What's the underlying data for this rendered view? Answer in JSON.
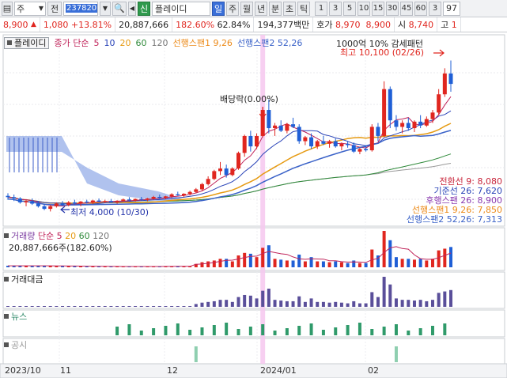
{
  "toolbar": {
    "btn_a": "주",
    "btn_b": "전",
    "code": "237820",
    "credit_badge": "신",
    "stock_name": "플레이디",
    "periods": [
      "일",
      "주",
      "월",
      "년",
      "분",
      "초",
      "틱"
    ],
    "active_period": "일",
    "numbers": [
      "1",
      "3",
      "5",
      "10",
      "15",
      "30",
      "45",
      "60",
      "3"
    ],
    "right_value": "97"
  },
  "info": {
    "price": "8,900",
    "arrow": "▲",
    "change": "1,080",
    "change_pct": "+13.81%",
    "volume": "20,887,666",
    "volume_ratio": "182.60%",
    "turnover": "62.84%",
    "amount": "194,377백만",
    "quote_label": "호가",
    "ask": "8,970",
    "bid": "8,900",
    "low_label": "시",
    "open": "8,740",
    "high_label": "고",
    "high": "1"
  },
  "legend": {
    "name_chip": "플레이디",
    "ma_label": "종가 단순",
    "ma_periods": [
      "5",
      "10",
      "20",
      "60",
      "120"
    ],
    "span1": "선행스팬1 9,26",
    "span2": "선행스팬2 52,26",
    "notice": "1000억 10% 감세패턴"
  },
  "annotations": {
    "high": "최고 10,100 (02/26)",
    "low": "최저 4,000 (10/30)",
    "dividend": "배당락(0.00%)"
  },
  "indicators": [
    {
      "label": "전환선 9: 8,080",
      "color": "#c8243a"
    },
    {
      "label": "기준선 26: 7,620",
      "color": "#2a44b8"
    },
    {
      "label": "후행스팬 26: 8,900",
      "color": "#8a3ab0"
    },
    {
      "label": "선행스팬1 9,26: 7,850",
      "color": "#ec8b1a"
    },
    {
      "label": "선행스팬2 52,26: 7,313",
      "color": "#3a62c8"
    }
  ],
  "volume_panel": {
    "title": "거래량",
    "ma_label": "단순",
    "ma_periods": [
      "5",
      "20",
      "60",
      "120"
    ],
    "current": "20,887,666주(182.60%)"
  },
  "amount_panel": {
    "title": "거래대금"
  },
  "news_panel": {
    "title": "뉴스"
  },
  "disclosure_panel": {
    "title": "공시"
  },
  "x_axis": [
    "2023/10",
    "11",
    "12",
    "2024/01",
    "02"
  ],
  "chart_data": {
    "type": "candlestick",
    "title": "플레이디",
    "period": "daily",
    "high": 10100,
    "high_date": "02/26",
    "low": 4000,
    "low_date": "10/30",
    "ohlc": [
      [
        4600,
        4700,
        4450,
        4550
      ],
      [
        4550,
        4650,
        4400,
        4500
      ],
      [
        4500,
        4550,
        4300,
        4350
      ],
      [
        4350,
        4450,
        4200,
        4400
      ],
      [
        4400,
        4500,
        4250,
        4300
      ],
      [
        4300,
        4400,
        4150,
        4200
      ],
      [
        4200,
        4300,
        4050,
        4100
      ],
      [
        4100,
        4250,
        4000,
        4200
      ],
      [
        4200,
        4350,
        4150,
        4300
      ],
      [
        4300,
        4400,
        4200,
        4250
      ],
      [
        4250,
        4400,
        4200,
        4350
      ],
      [
        4350,
        4450,
        4250,
        4300
      ],
      [
        4300,
        4400,
        4200,
        4380
      ],
      [
        4380,
        4450,
        4300,
        4350
      ],
      [
        4350,
        4450,
        4280,
        4420
      ],
      [
        4420,
        4500,
        4350,
        4380
      ],
      [
        4380,
        4450,
        4320,
        4400
      ],
      [
        4400,
        4480,
        4330,
        4360
      ],
      [
        4360,
        4430,
        4300,
        4410
      ],
      [
        4410,
        4500,
        4380,
        4460
      ],
      [
        4460,
        4550,
        4400,
        4420
      ],
      [
        4420,
        4500,
        4380,
        4480
      ],
      [
        4480,
        4560,
        4420,
        4450
      ],
      [
        4450,
        4520,
        4400,
        4500
      ],
      [
        4500,
        4600,
        4450,
        4560
      ],
      [
        4560,
        4650,
        4480,
        4520
      ],
      [
        4520,
        4600,
        4470,
        4580
      ],
      [
        4580,
        4700,
        4520,
        4660
      ],
      [
        4660,
        4760,
        4600,
        4620
      ],
      [
        4620,
        4700,
        4560,
        4680
      ],
      [
        4680,
        4800,
        4620,
        4750
      ],
      [
        4750,
        4900,
        4700,
        4850
      ],
      [
        4850,
        5100,
        4800,
        5050
      ],
      [
        5050,
        5350,
        5000,
        5250
      ],
      [
        5250,
        5600,
        5200,
        5550
      ],
      [
        5550,
        5900,
        5400,
        5650
      ],
      [
        5650,
        5800,
        5300,
        5400
      ],
      [
        5400,
        5700,
        5350,
        5650
      ],
      [
        5650,
        6300,
        5600,
        6250
      ],
      [
        6250,
        6950,
        6100,
        6900
      ],
      [
        6900,
        7100,
        6300,
        6500
      ],
      [
        6500,
        7000,
        6400,
        6900
      ],
      [
        6900,
        8000,
        6850,
        7900
      ],
      [
        7900,
        8300,
        7000,
        7200
      ],
      [
        7200,
        7400,
        6900,
        7300
      ],
      [
        7300,
        7500,
        7050,
        7100
      ],
      [
        7100,
        7400,
        7000,
        7350
      ],
      [
        7350,
        7600,
        7200,
        7250
      ],
      [
        7250,
        7350,
        6600,
        6700
      ],
      [
        6700,
        6900,
        6550,
        6850
      ],
      [
        6850,
        7000,
        6400,
        6500
      ],
      [
        6500,
        6750,
        6400,
        6700
      ],
      [
        6700,
        6900,
        6550,
        6600
      ],
      [
        6600,
        6750,
        6450,
        6700
      ],
      [
        6700,
        6800,
        6450,
        6500
      ],
      [
        6500,
        6650,
        6350,
        6600
      ],
      [
        6600,
        6700,
        6450,
        6550
      ],
      [
        6550,
        6650,
        6250,
        6300
      ],
      [
        6300,
        6450,
        6200,
        6400
      ],
      [
        6400,
        6550,
        6300,
        6350
      ],
      [
        6350,
        7350,
        6300,
        7250
      ],
      [
        7250,
        7400,
        6700,
        6900
      ],
      [
        6900,
        9000,
        6850,
        8700
      ],
      [
        8700,
        8800,
        7200,
        7500
      ],
      [
        7500,
        7700,
        7100,
        7250
      ],
      [
        7250,
        7500,
        7000,
        7400
      ],
      [
        7400,
        7600,
        7100,
        7200
      ],
      [
        7200,
        7500,
        7050,
        7450
      ],
      [
        7450,
        7700,
        7200,
        7300
      ],
      [
        7300,
        7650,
        7250,
        7550
      ],
      [
        7550,
        7900,
        7400,
        7800
      ],
      [
        7800,
        8700,
        7700,
        8500
      ],
      [
        8500,
        9500,
        8400,
        9300
      ],
      [
        9300,
        9800,
        8600,
        8900
      ]
    ]
  }
}
